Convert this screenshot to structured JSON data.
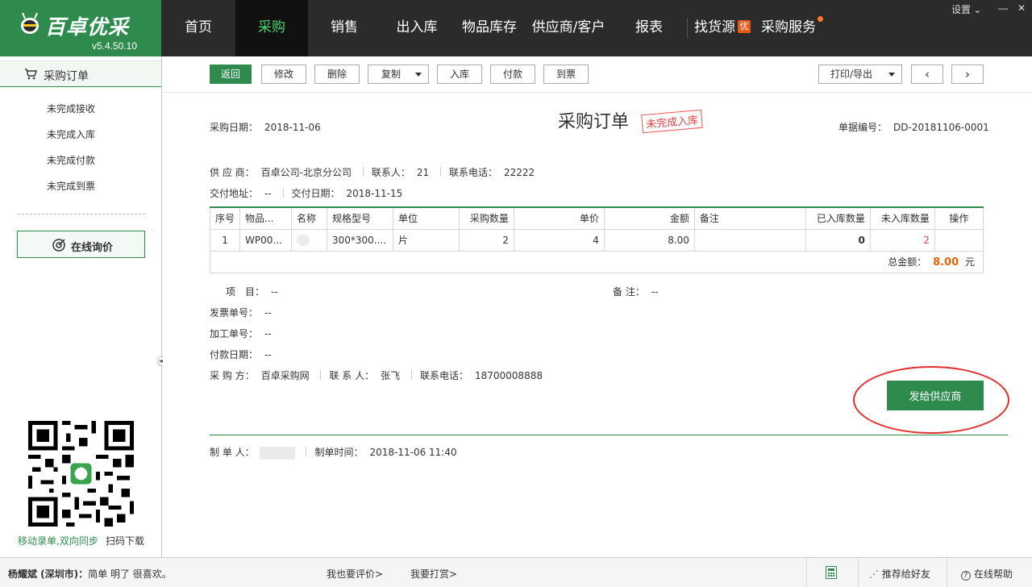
{
  "app": {
    "brand": "百卓优采",
    "version": "v5.4.50.10",
    "nav": [
      {
        "label": "首页"
      },
      {
        "label": "采购"
      },
      {
        "label": "销售"
      },
      {
        "label": "出入库"
      },
      {
        "label": "物品库存"
      },
      {
        "label": "供应商/客户"
      },
      {
        "label": "报表"
      },
      {
        "label": "找货源",
        "badge": "优"
      },
      {
        "label": "采购服务"
      }
    ],
    "settings_label": "设置",
    "accent": "#2e8b4d",
    "topbar_color": "#2b2b2b"
  },
  "sidebar": {
    "title": "采购订单",
    "links": [
      "未完成接收",
      "未完成入库",
      "未完成付款",
      "未完成到票"
    ],
    "inquiry": "在线询价",
    "qr_left": "移动录单,双向同步",
    "qr_right": "扫码下载"
  },
  "toolbar": {
    "back": "返回",
    "edit": "修改",
    "delete": "删除",
    "copy": "复制",
    "stock_in": "入库",
    "pay": "付款",
    "invoice": "到票",
    "print": "打印/导出",
    "prev": "‹",
    "next": "›"
  },
  "order": {
    "title": "采购订单",
    "status_stamp": "未完成入库",
    "date_label": "采购日期：",
    "date": "2018-11-06",
    "no_label": "单据编号：",
    "no": "DD-20181106-0001",
    "supplier_label": "供 应 商：",
    "supplier": "百卓公司-北京分公司",
    "contact_label": "联系人：",
    "contact": "21",
    "phone_label": "联系电话：",
    "phone": "22222",
    "addr_label": "交付地址：",
    "addr": "--",
    "deliver_label": "交付日期：",
    "deliver": "2018-11-15",
    "columns": [
      "序号",
      "物品...",
      "名称",
      "规格型号",
      "单位",
      "采购数量",
      "单价",
      "金额",
      "备注",
      "已入库数量",
      "未入库数量",
      "操作"
    ],
    "rows": [
      {
        "no": "1",
        "item": "WP00...",
        "name": "",
        "spec": "300*300....",
        "unit": "片",
        "qty": "2",
        "price": "4",
        "amount": "8.00",
        "remark": "",
        "in": "0",
        "not_in": "2",
        "op": ""
      }
    ],
    "total_label": "总金额：",
    "total": "8.00",
    "total_unit": "元",
    "project_label": "项　目：",
    "project": "--",
    "remark_label": "备 注：",
    "remark": "--",
    "invoice_no_label": "发票单号：",
    "invoice_no": "--",
    "process_no_label": "加工单号：",
    "process_no": "--",
    "pay_date_label": "付款日期：",
    "pay_date": "--",
    "buyer_label": "采 购 方：",
    "buyer": "百卓采购网",
    "buyer_contact_label": "联 系 人：",
    "buyer_contact": "张飞",
    "buyer_phone_label": "联系电话：",
    "buyer_phone": "18700008888",
    "send_button": "发给供应商",
    "maker_label": "制 单 人：",
    "make_time_label": "制单时间：",
    "make_time": "2018-11-06 11:40"
  },
  "statusbar": {
    "user": "杨耀斌 (深圳市)：",
    "motto": "简单 明了  很喜欢。",
    "rate": "我也要评价>",
    "tip": "我要打赏>",
    "recommend": "推荐给好友",
    "help": "在线帮助"
  }
}
